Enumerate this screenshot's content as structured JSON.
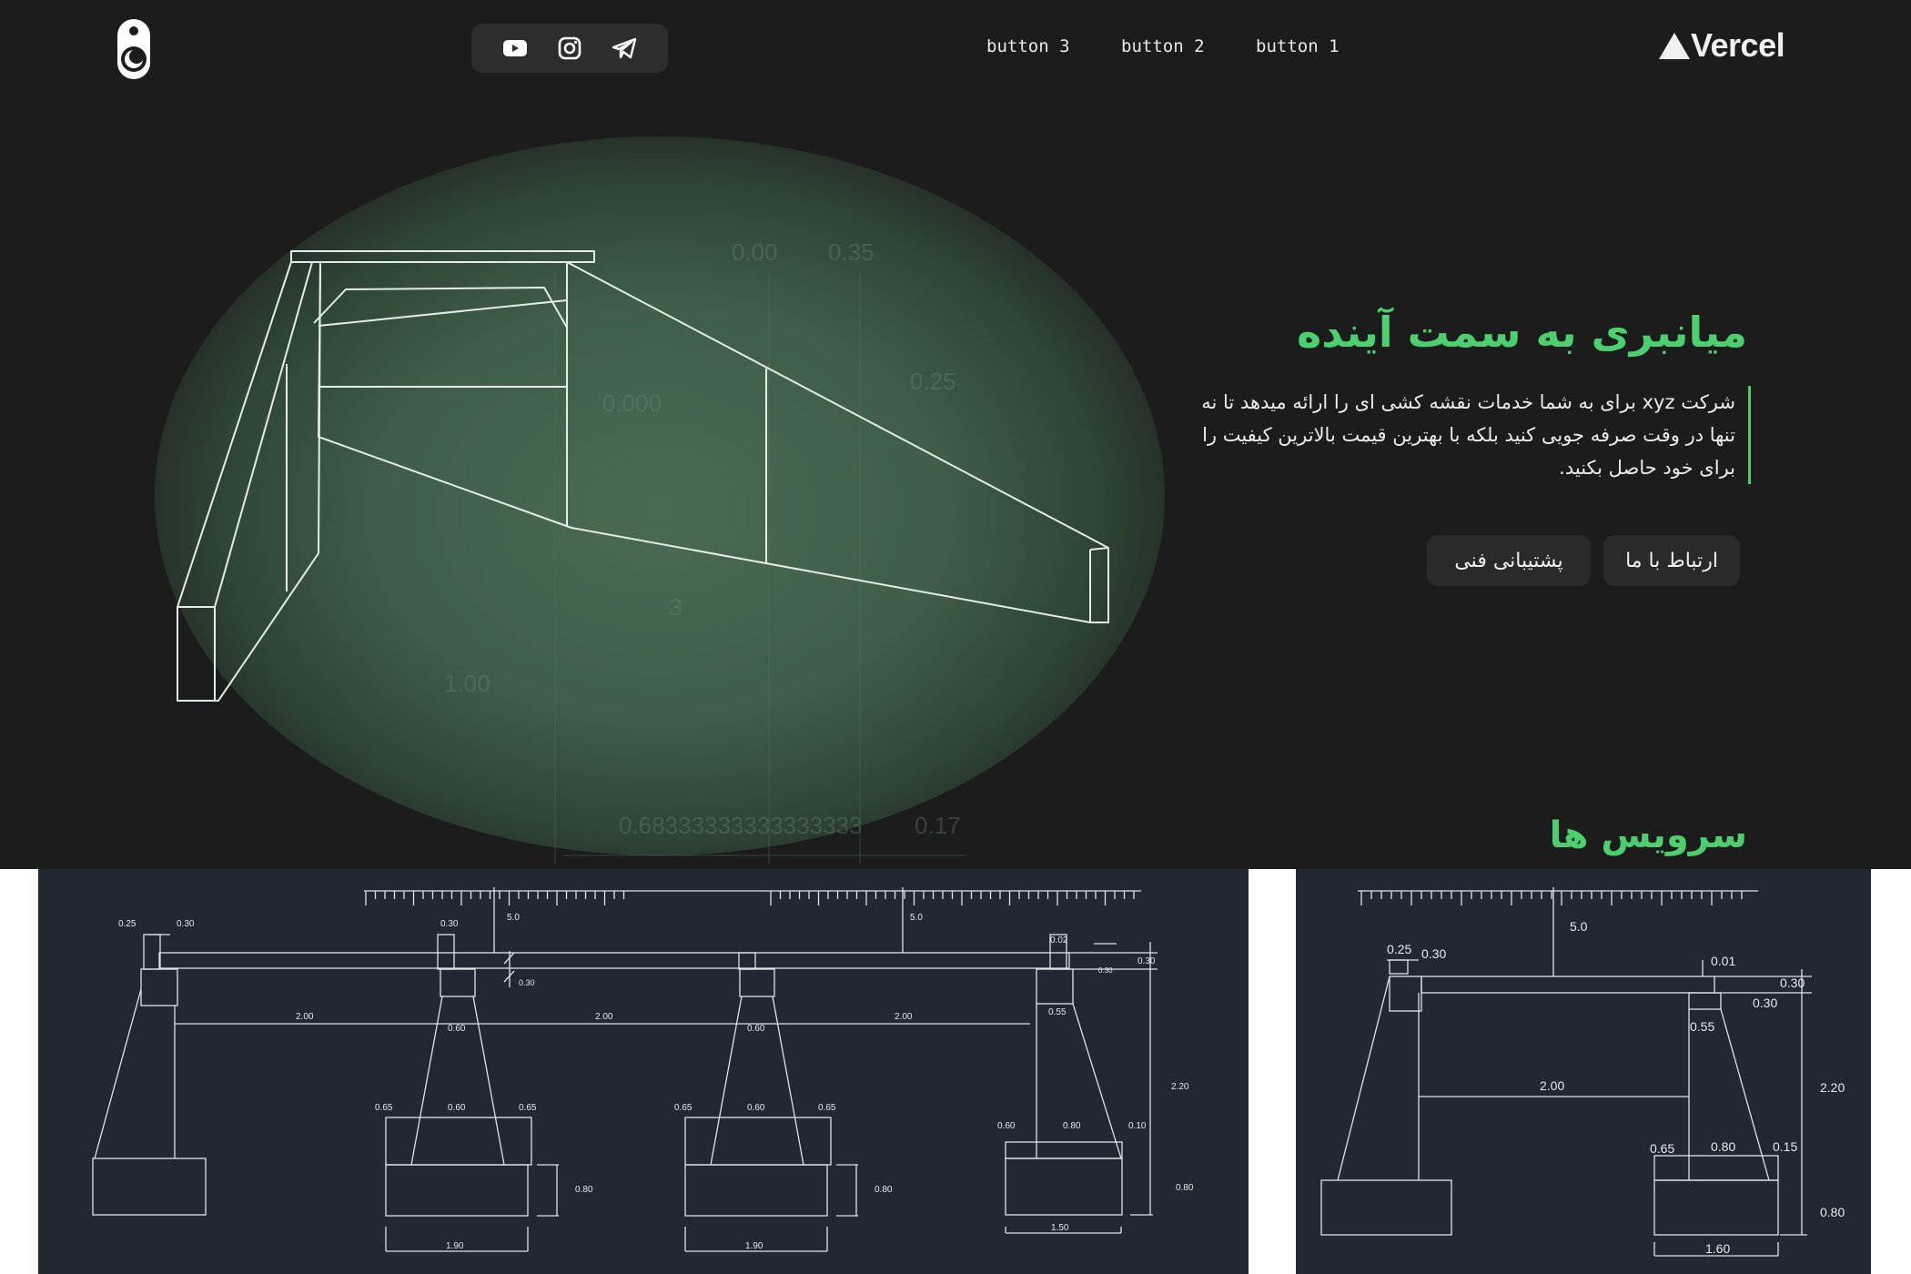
{
  "nav": {
    "buttons": [
      "button 3",
      "button 2",
      "button 1"
    ],
    "social_icons": [
      "youtube-icon",
      "instagram-icon",
      "telegram-icon"
    ],
    "brand": "Vercel"
  },
  "hero": {
    "headline": "میانبری به سمت آینده",
    "description": "شرکت xyz برای به شما خدمات نقشه کشی ای را ارائه میدهد تا نه تنها در وقت صرفه جویی کنید بلکه با بهترین قیمت بالاترین کیفیت را برای خود حاصل بکنید.",
    "primary_button": "ارتباط با ما",
    "secondary_button": "پشتیبانی فنی",
    "drawing_labels": [
      "0.00",
      "0.35",
      "0.25",
      "0.000",
      "3",
      "1.00",
      "0.68333333333333333",
      "0.17"
    ]
  },
  "services": {
    "title": "سرویس ها"
  },
  "drawing_left": {
    "labels": {
      "a": "0.25",
      "b": "0.30",
      "c": "5.0",
      "d": "0.30",
      "e": "5.0",
      "f": "0.02",
      "g": "0.30",
      "h": "0.30",
      "i": "2.00",
      "j": "0.60",
      "k": "2.00",
      "l": "0.60",
      "m": "2.00",
      "n": "0.55",
      "o": "2.20",
      "p": "0.65",
      "q": "0.60",
      "r": "0.65",
      "s": "0.65",
      "t": "0.60",
      "u": "0.65",
      "v": "0.60",
      "w": "0.80",
      "x": "0.10",
      "y": "0.80",
      "z": "0.80",
      "aa": "0.80",
      "bb": "1.90",
      "cc": "1.90",
      "dd": "1.50",
      "ee": "0.30"
    }
  },
  "drawing_right": {
    "labels": {
      "a": "5.0",
      "b": "0.25",
      "c": "0.30",
      "d": "0.01",
      "e": "0.30",
      "f": "0.30",
      "g": "0.55",
      "h": "2.00",
      "i": "2.20",
      "j": "0.65",
      "k": "0.80",
      "l": "0.15",
      "m": "0.80",
      "n": "1.60"
    }
  },
  "colors": {
    "accent": "#4ccf6e",
    "hero_bg": "#1c1c1c",
    "drawing_bg": "#222831"
  }
}
